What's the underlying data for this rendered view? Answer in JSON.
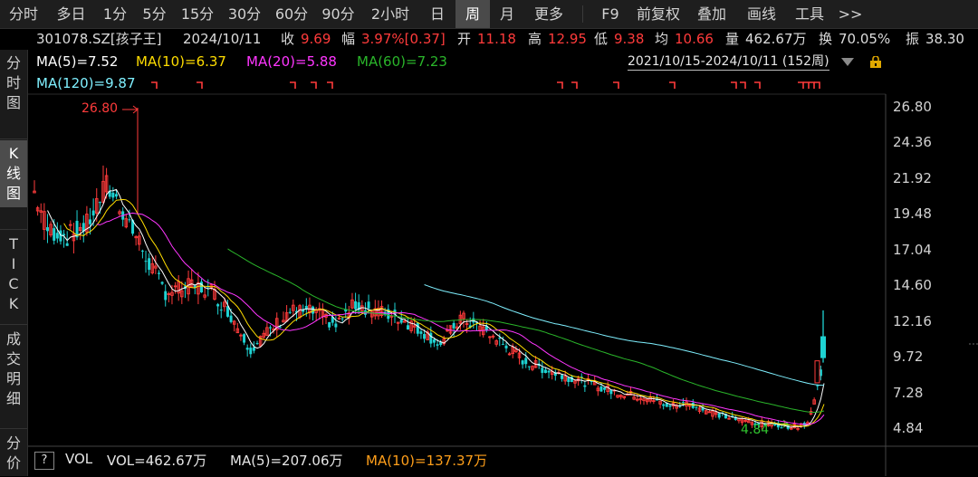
{
  "toolbar": {
    "items": [
      "分时",
      "多日",
      "1分",
      "5分",
      "15分",
      "30分",
      "60分",
      "90分",
      "2小时",
      "日",
      "周",
      "月",
      "更多",
      "F9",
      "前复权",
      "叠加",
      "画线",
      "工具",
      ">>"
    ],
    "active": "周"
  },
  "quote": {
    "code_name": "301078.SZ[孩子王]",
    "date": "2024/10/11",
    "close_label": "收",
    "close": "9.69",
    "change_label": "幅",
    "change": "3.97%[0.37]",
    "open_label": "开",
    "open": "11.18",
    "high_label": "高",
    "high": "12.95",
    "low_label": "低",
    "low": "9.38",
    "avg_label": "均",
    "avg": "10.66",
    "vol_label": "量",
    "vol": "462.67万",
    "turnover_label": "换",
    "turnover": "70.05%",
    "amp_label": "振",
    "amp": "38.30"
  },
  "sidebar": {
    "tabs": [
      "分时图",
      "K线图",
      "TICK",
      "成交明细",
      "分价"
    ],
    "active": "K线图"
  },
  "legend": {
    "ma5": "MA(5)=7.52",
    "ma10": "MA(10)=6.37",
    "ma20": "MA(20)=5.88",
    "ma60": "MA(60)=7.23",
    "ma120": "MA(120)=9.87"
  },
  "range": "2021/10/15-2024/10/11 (152周)",
  "annotations": {
    "peak": "26.80",
    "low": "4.84"
  },
  "volume": {
    "help": "?",
    "label": "VOL",
    "vol": "VOL=462.67万",
    "ma5": "MA(5)=207.06万",
    "ma10": "MA(10)=137.37万"
  },
  "colors": {
    "up": "#ff3b3b",
    "down": "#1ed3d3",
    "ma5": "#ffffff",
    "ma10": "#ffdd00",
    "ma20": "#ff36ff",
    "ma60": "#2ab52a",
    "ma120": "#7ff0ff"
  },
  "chart_data": {
    "type": "candlestick",
    "y_ticks": [
      "26.80",
      "24.36",
      "21.92",
      "19.48",
      "17.04",
      "14.60",
      "12.16",
      "9.72",
      "7.28",
      "4.84"
    ],
    "ylim": [
      4.84,
      26.8
    ],
    "note_points": {
      "peak": 26.8,
      "low": 4.84
    },
    "last_bar": {
      "open": 11.18,
      "high": 12.95,
      "low": 9.38,
      "close": 9.69
    }
  }
}
